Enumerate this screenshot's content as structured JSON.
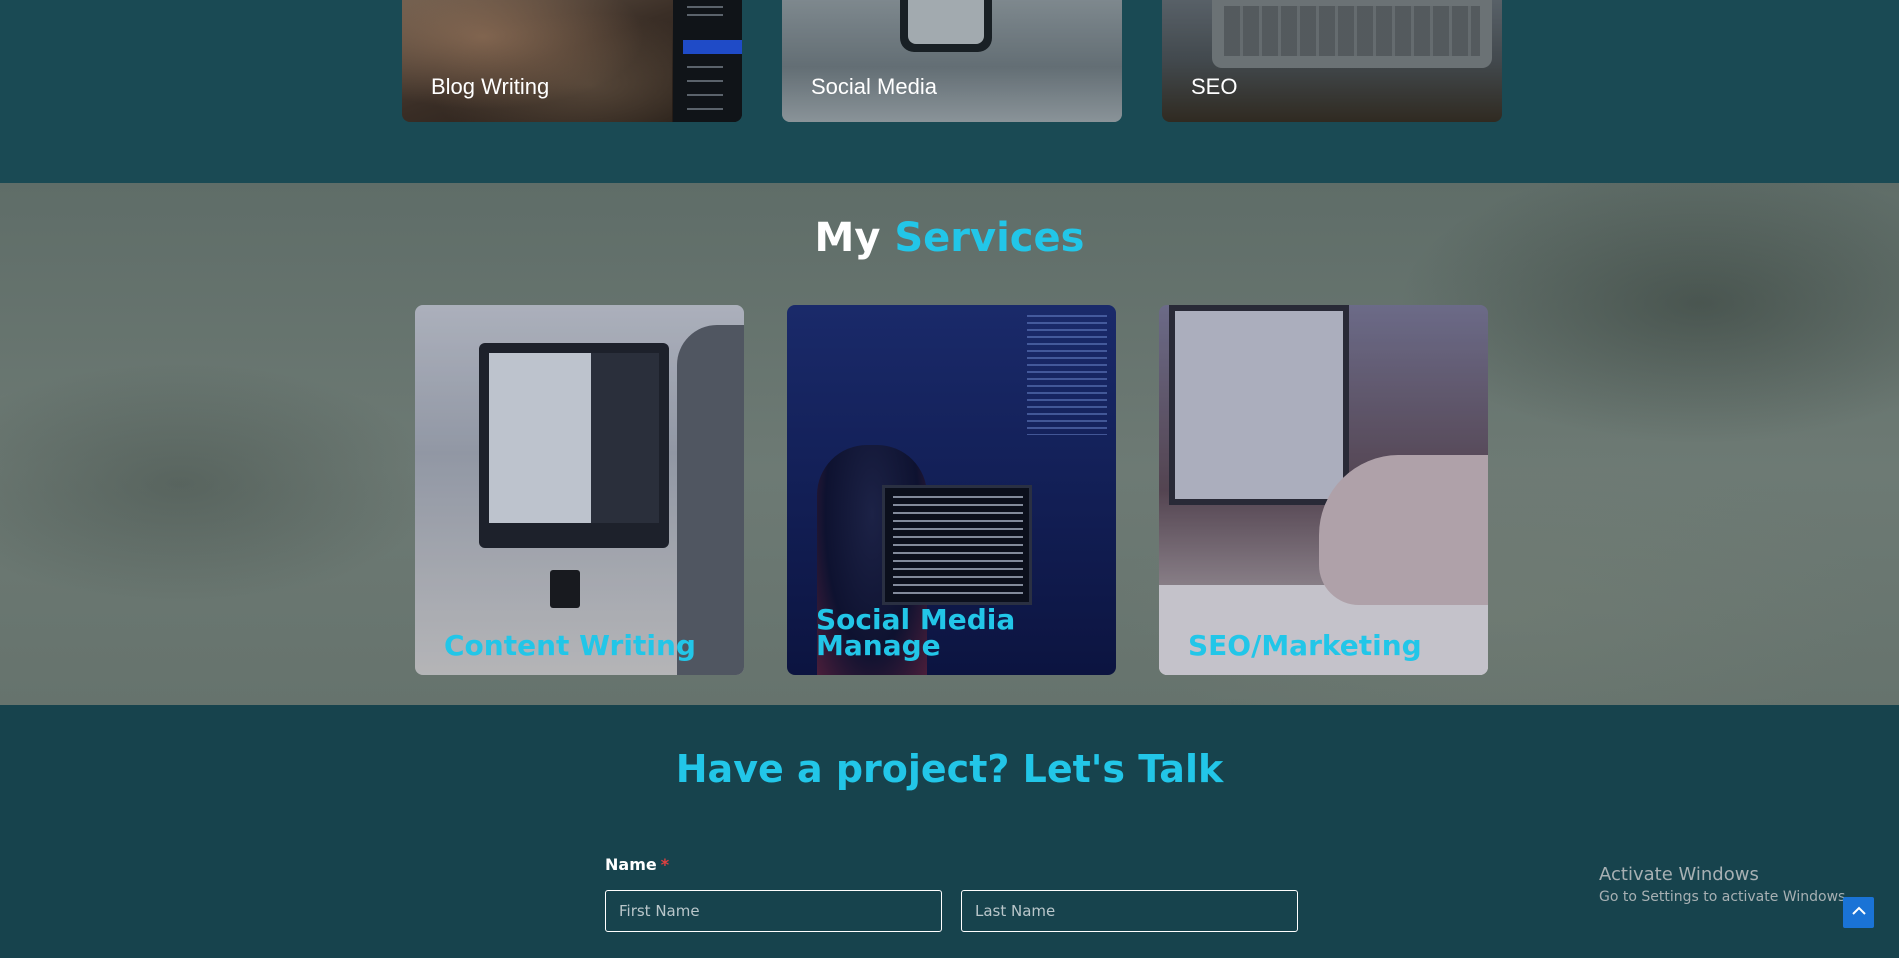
{
  "portfolio": {
    "cards": [
      {
        "label": "Blog Writing"
      },
      {
        "label": "Social Media"
      },
      {
        "label": "SEO"
      }
    ]
  },
  "services": {
    "title_white": "My",
    "title_accent": "Services",
    "cards": [
      {
        "label": "Content Writing"
      },
      {
        "label": "Social Media Manage"
      },
      {
        "label": "SEO/Marketing"
      }
    ]
  },
  "contact": {
    "title": "Have a project? Let's Talk",
    "name_label": "Name",
    "required_mark": "*",
    "first_name_placeholder": "First Name",
    "last_name_placeholder": "Last Name"
  },
  "os_watermark": {
    "line1": "Activate Windows",
    "line2": "Go to Settings to activate Windows."
  },
  "icons": {
    "back_to_top": "chevron-up-icon"
  },
  "colors": {
    "accent": "#22c6e8",
    "section_bg": "#17434d",
    "button_blue": "#1a73d6"
  }
}
